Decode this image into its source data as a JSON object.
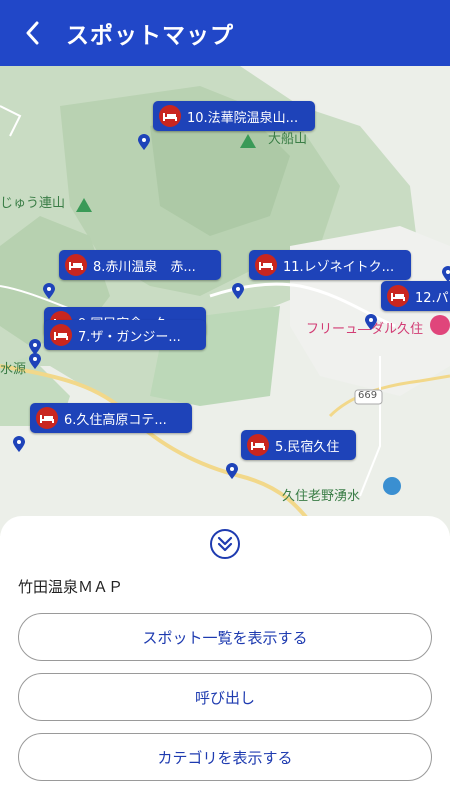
{
  "header": {
    "title": "スポットマップ",
    "back_icon": "chevron-left-icon",
    "bg_color": "#2147c8"
  },
  "map": {
    "place_labels": {
      "daisenzan": "大船山",
      "kuju_rensan": "じゅう連山",
      "suigen": "水源",
      "flower_park": "フリーュ―ダル久住",
      "road_669": "669",
      "wakimizu": "久住老野湧水"
    },
    "spots": [
      {
        "label": "10.法華院温泉山..."
      },
      {
        "label": "8.赤川温泉　赤..."
      },
      {
        "label": "11.レゾネイトク..."
      },
      {
        "label": "12.パ"
      },
      {
        "label": "9.国民宿舎　久..."
      },
      {
        "label": "7.ザ・ガンジー..."
      },
      {
        "label": "6.久住高原コテ..."
      },
      {
        "label": "5.民宿久住"
      }
    ],
    "spot_color": "#1e43b9",
    "bed_icon_color": "#c9261f"
  },
  "sheet": {
    "collapse_icon": "double-chevron-down-icon",
    "title": "竹田温泉ＭＡＰ",
    "buttons": {
      "list": "スポット一覧を表示する",
      "call": "呼び出し",
      "category": "カテゴリを表示する"
    }
  }
}
